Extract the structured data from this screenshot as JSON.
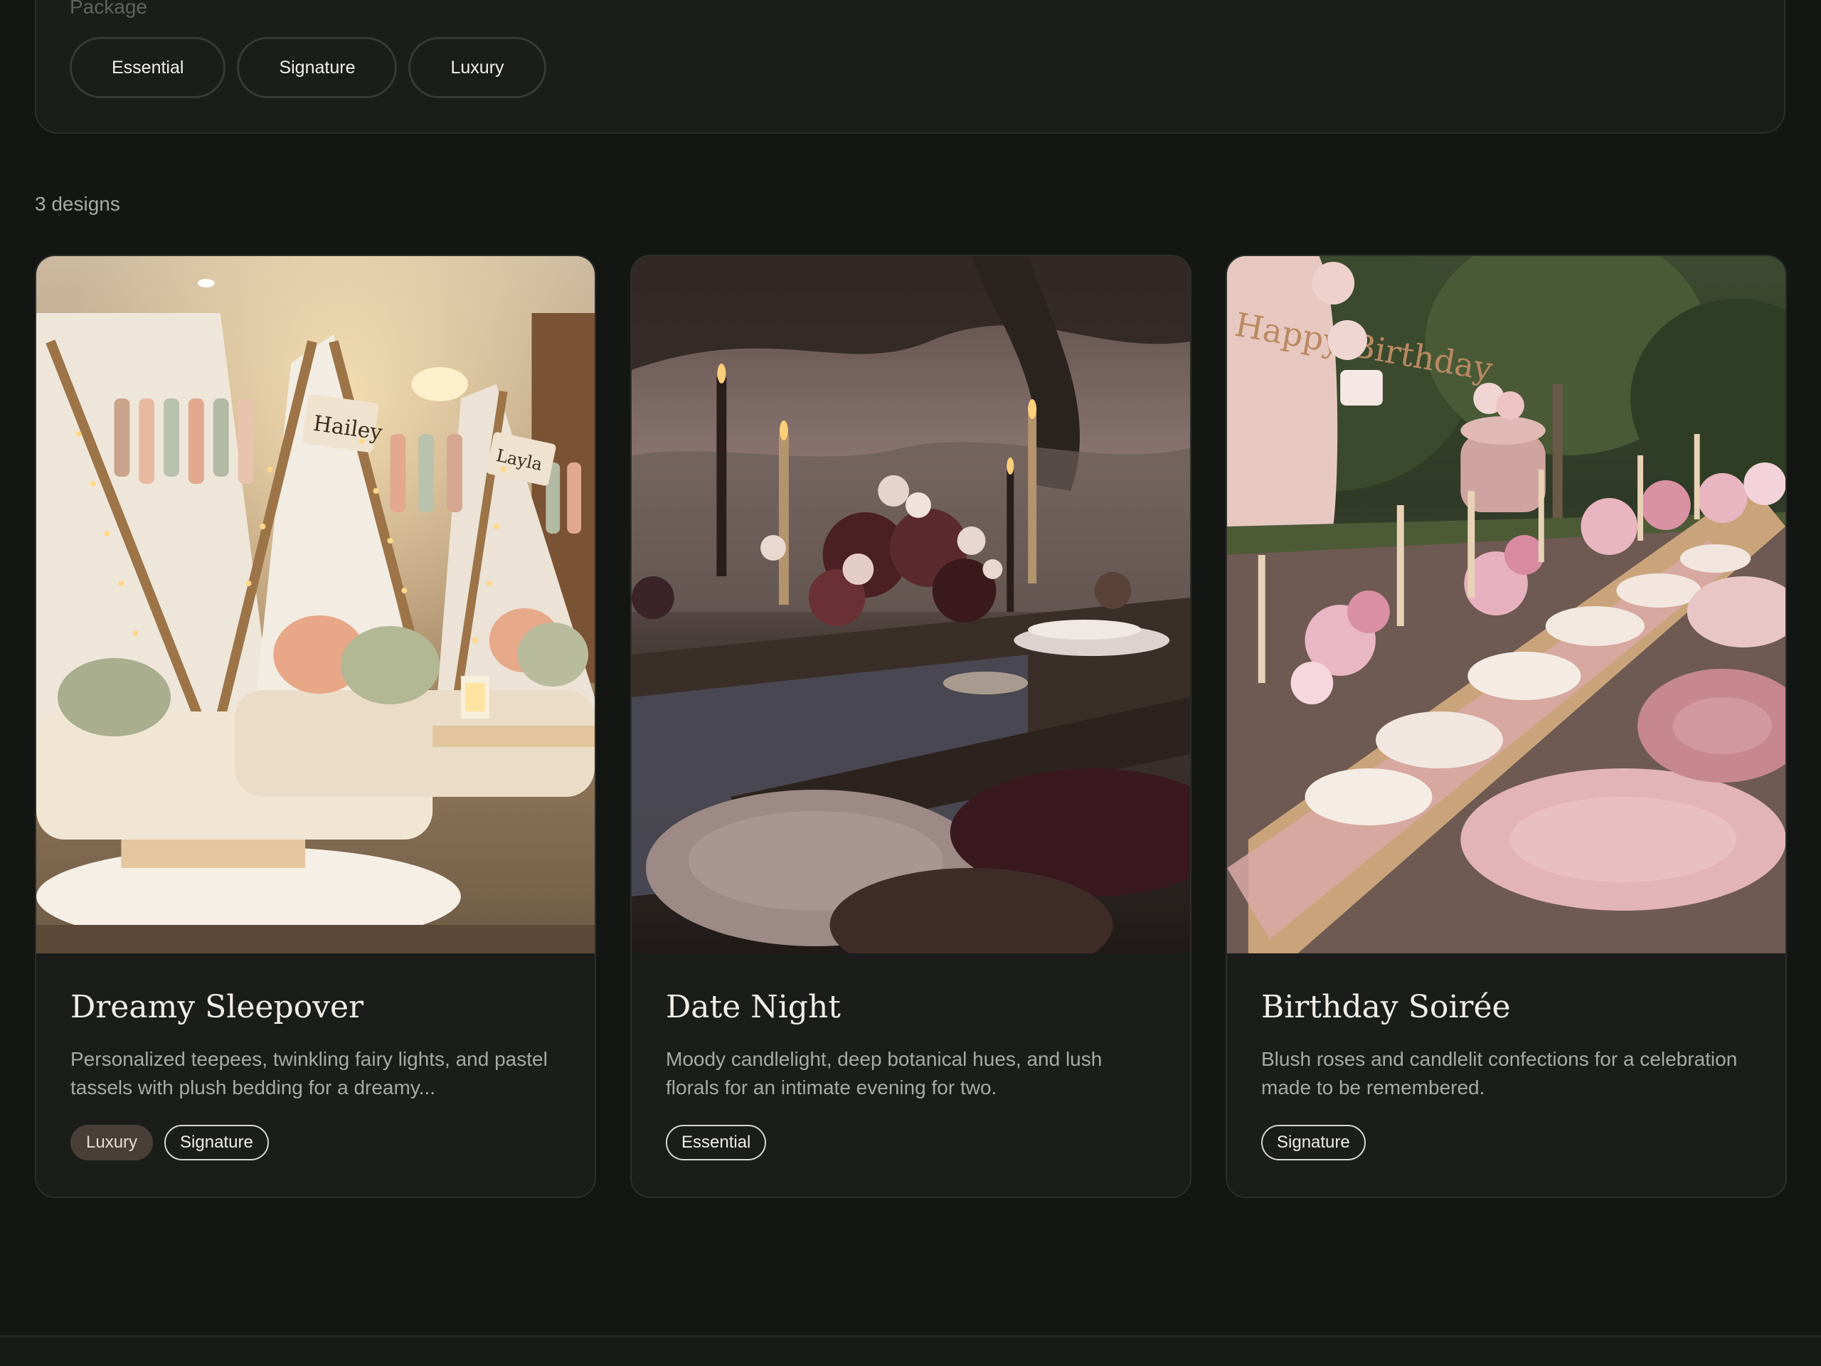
{
  "filters": {
    "label": "Package",
    "packages": [
      "Essential",
      "Signature",
      "Luxury"
    ]
  },
  "results": {
    "count_text": "3 designs"
  },
  "cards": [
    {
      "title": "Dreamy Sleepover",
      "description": "Personalized teepees, twinkling fairy lights, and pastel tassels with plush bedding for a dreamy...",
      "tags": [
        {
          "label": "Luxury",
          "style": "filled"
        },
        {
          "label": "Signature",
          "style": "outline"
        }
      ],
      "image_signs": [
        "Hailey",
        "Layla"
      ]
    },
    {
      "title": "Date Night",
      "description": "Moody candlelight, deep botanical hues, and lush florals for an intimate evening for two.",
      "tags": [
        {
          "label": "Essential",
          "style": "outline"
        }
      ]
    },
    {
      "title": "Birthday Soirée",
      "description": "Blush roses and candlelit confections for a celebration made to be remembered.",
      "tags": [
        {
          "label": "Signature",
          "style": "outline"
        }
      ],
      "image_signs": [
        "Happy Birthday"
      ]
    }
  ],
  "colors": {
    "background": "#141614",
    "card": "#1b1d1b",
    "border": "#2b2e2b",
    "tag_filled": "#4a3e39"
  }
}
